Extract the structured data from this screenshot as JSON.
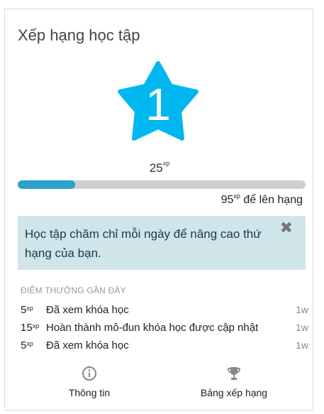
{
  "card": {
    "title": "Xếp hạng học tập"
  },
  "rank": {
    "number": "1",
    "xp_value": "25",
    "xp_unit": "xp",
    "star_color": "#00b7f0"
  },
  "progress": {
    "fraction": 0.2,
    "fill_color": "#2aa2cc",
    "track_color": "#cfcfcf",
    "next_value": "95",
    "next_unit": "xp",
    "next_text": " để lên hạng"
  },
  "tip": {
    "text": "Học tập chăm chỉ mỗi ngày để nâng cao thứ hạng của bạn.",
    "close_glyph": "✖",
    "background": "#cfe5ea"
  },
  "recent": {
    "heading": "ĐIỂM THƯỞNG GẦN ĐÂY",
    "items": [
      {
        "points": "5",
        "unit": "xp",
        "description": "Đã xem khóa học",
        "when": "1w"
      },
      {
        "points": "15",
        "unit": "xp",
        "description": "Hoàn thành mô-đun khóa học được cập nhật",
        "when": "1w"
      },
      {
        "points": "5",
        "unit": "xp",
        "description": "Đã xem khóa học",
        "when": "1w"
      }
    ]
  },
  "footer": {
    "info": {
      "label": "Thông tin",
      "icon": "info-circle-icon"
    },
    "leaderboard": {
      "label": "Bảng xếp hạng",
      "icon": "trophy-icon"
    }
  }
}
